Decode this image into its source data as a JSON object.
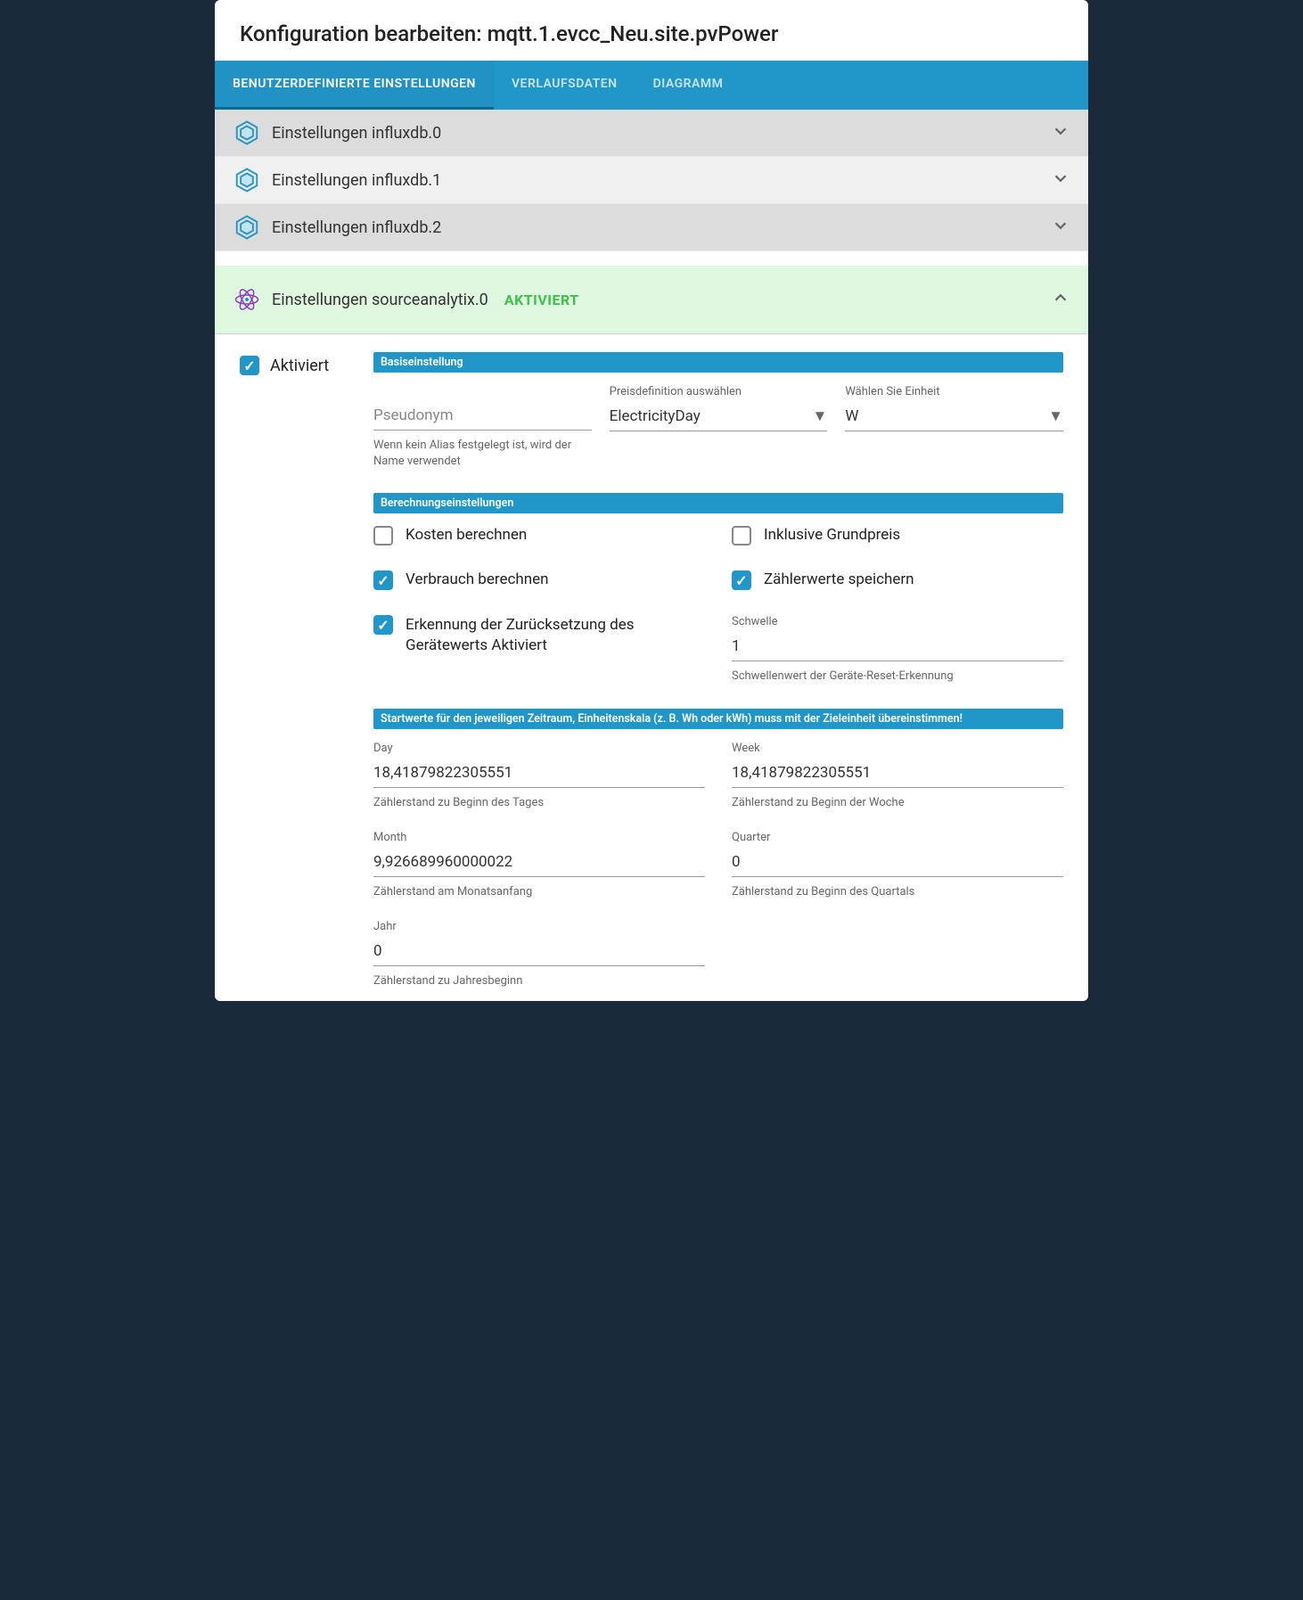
{
  "dialog": {
    "title": "Konfiguration bearbeiten: mqtt.1.evcc_Neu.site.pvPower"
  },
  "tabs": {
    "user_settings": "BENUTZERDEFINIERTE EINSTELLUNGEN",
    "history": "VERLAUFSDATEN",
    "chart": "DIAGRAMM"
  },
  "panels": {
    "influx0": "Einstellungen influxdb.0",
    "influx1": "Einstellungen influxdb.1",
    "influx2": "Einstellungen influxdb.2",
    "sourceanalytix": "Einstellungen sourceanalytix.0",
    "activated_badge": "AKTIVIERT"
  },
  "activated": {
    "label": "Aktiviert"
  },
  "sections": {
    "base": "Basiseinstellung",
    "calc": "Berechnungseinstellungen",
    "start": "Startwerte für den jeweiligen Zeitraum, Einheitenskala (z. B. Wh oder kWh) muss mit der Zieleinheit übereinstimmen!"
  },
  "base": {
    "alias_placeholder": "Pseudonym",
    "alias_help": "Wenn kein Alias festgelegt ist, wird der Name verwendet",
    "price_label": "Preisdefinition auswählen",
    "price_value": "ElectricityDay",
    "unit_label": "Wählen Sie Einheit",
    "unit_value": "W"
  },
  "calc": {
    "kosten": "Kosten berechnen",
    "grundpreis": "Inklusive Grundpreis",
    "verbrauch": "Verbrauch berechnen",
    "zaehler_speichern": "Zählerwerte speichern",
    "reset_detect": "Erkennung der Zurücksetzung des Gerätewerts Aktiviert",
    "schwelle_label": "Schwelle",
    "schwelle_value": "1",
    "schwelle_help": "Schwellenwert der Geräte-Reset-Erkennung"
  },
  "start": {
    "day_label": "Day",
    "day_value": "18,41879822305551",
    "day_help": "Zählerstand zu Beginn des Tages",
    "week_label": "Week",
    "week_value": "18,41879822305551",
    "week_help": "Zählerstand zu Beginn der Woche",
    "month_label": "Month",
    "month_value": "9,926689960000022",
    "month_help": "Zählerstand am Monatsanfang",
    "quarter_label": "Quarter",
    "quarter_value": "0",
    "quarter_help": "Zählerstand zu Beginn des Quartals",
    "year_label": "Jahr",
    "year_value": "0",
    "year_help": "Zählerstand zu Jahresbeginn"
  }
}
